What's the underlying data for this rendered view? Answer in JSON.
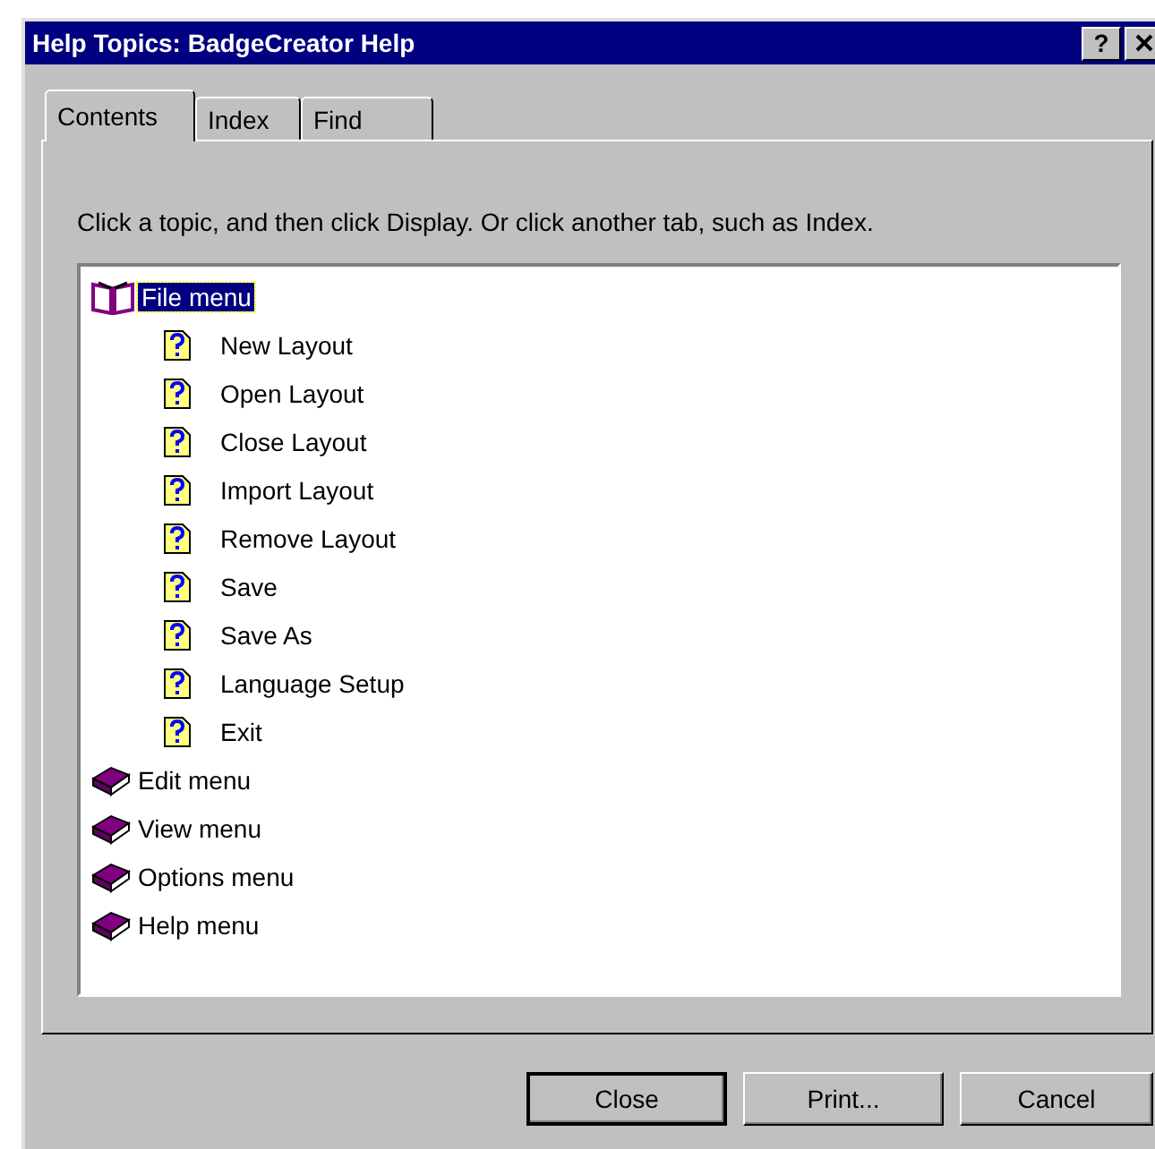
{
  "window": {
    "title": "Help Topics: BadgeCreator Help",
    "title_buttons": [
      "?"
    ]
  },
  "tabs": [
    {
      "label": "Contents",
      "selected": true
    },
    {
      "label": "Index",
      "selected": false
    },
    {
      "label": "Find",
      "selected": false
    }
  ],
  "instruction": "Click a topic, and then click Display. Or click another tab, such as Index.",
  "tree": [
    {
      "label": "File menu",
      "kind": "book",
      "expanded": true,
      "selected": true,
      "children": [
        {
          "label": "New Layout",
          "kind": "topic",
          "selected": false
        },
        {
          "label": "Open Layout",
          "kind": "topic",
          "selected": false
        },
        {
          "label": "Close Layout",
          "kind": "topic",
          "selected": false
        },
        {
          "label": "Import Layout",
          "kind": "topic",
          "selected": false
        },
        {
          "label": "Remove Layout",
          "kind": "topic",
          "selected": false
        },
        {
          "label": "Save",
          "kind": "topic",
          "selected": false
        },
        {
          "label": "Save As",
          "kind": "topic",
          "selected": false
        },
        {
          "label": "Language Setup",
          "kind": "topic",
          "selected": false
        },
        {
          "label": "Exit",
          "kind": "topic",
          "selected": false
        }
      ]
    },
    {
      "label": "Edit menu",
      "kind": "book",
      "expanded": false,
      "selected": false
    },
    {
      "label": "View menu",
      "kind": "book",
      "expanded": false,
      "selected": false
    },
    {
      "label": "Options menu",
      "kind": "book",
      "expanded": false,
      "selected": false
    },
    {
      "label": "Help menu",
      "kind": "book",
      "expanded": false,
      "selected": false
    }
  ],
  "buttons": [
    {
      "label": "Close",
      "default": true
    },
    {
      "label": "Print...",
      "default": false
    },
    {
      "label": "Cancel",
      "default": false
    }
  ]
}
